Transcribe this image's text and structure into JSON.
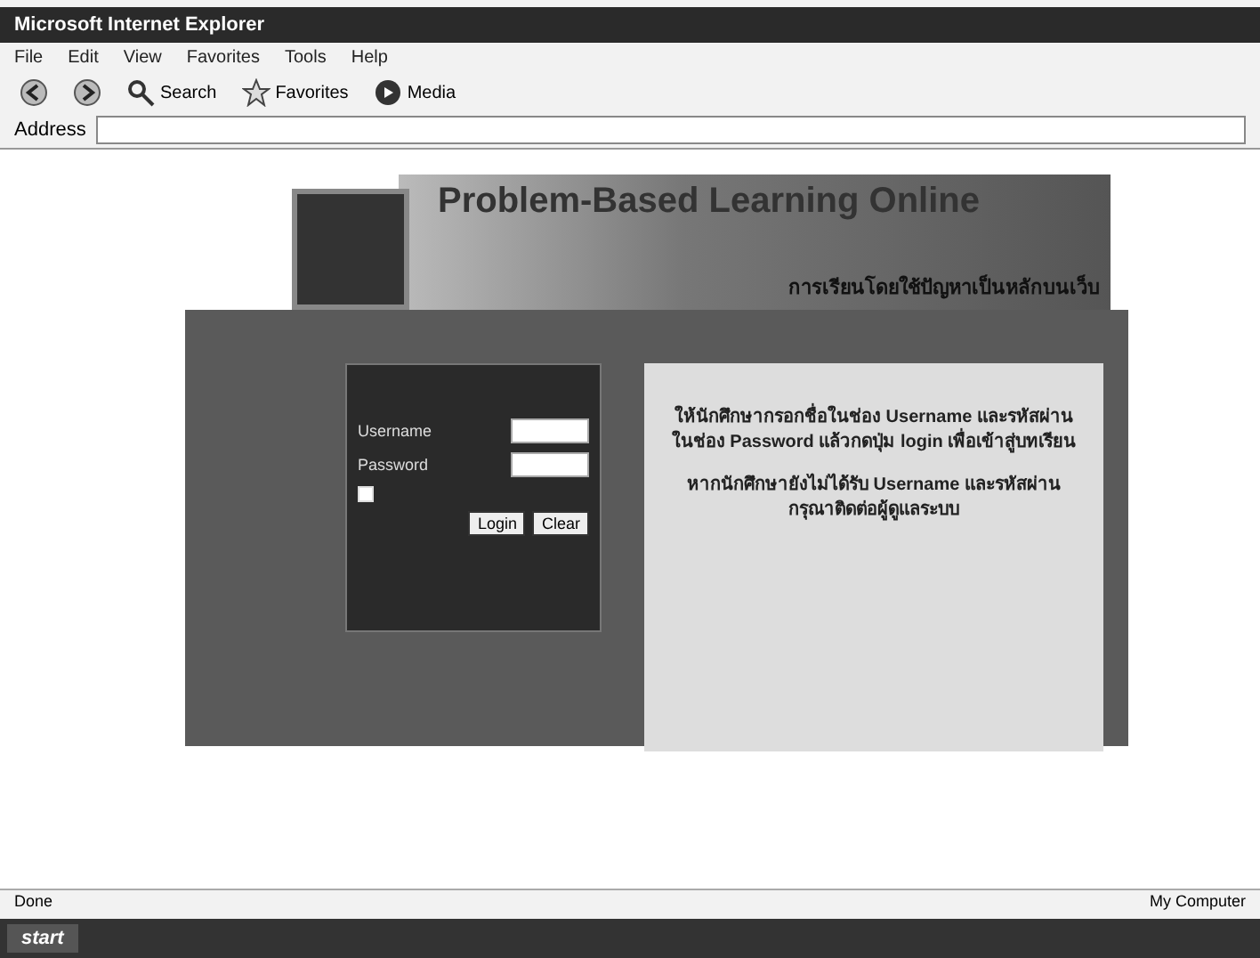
{
  "window": {
    "title": "Microsoft Internet Explorer"
  },
  "menu": [
    "File",
    "Edit",
    "View",
    "Favorites",
    "Tools",
    "Help"
  ],
  "toolbar": [
    {
      "kind": "back"
    },
    {
      "kind": "forward"
    },
    {
      "kind": "search",
      "label": "Search"
    },
    {
      "kind": "favorites",
      "label": "Favorites"
    },
    {
      "kind": "media",
      "label": "Media"
    }
  ],
  "address_bar": {
    "label": "Address"
  },
  "banner": {
    "title": "Problem-Based Learning Online",
    "subtitle": "การเรียนโดยใช้ปัญหาเป็นหลักบนเว็บ"
  },
  "login": {
    "username_label": "Username",
    "password_label": "Password",
    "remember": {
      "checked": false
    },
    "buttons": [
      "Login",
      "Clear"
    ]
  },
  "info": {
    "paragraphs": [
      "ให้นักศึกษากรอกชื่อในช่อง Username และรหัสผ่านในช่อง Password แล้วกดปุ่ม login เพื่อเข้าสู่บทเรียน",
      "หากนักศึกษายังไม่ได้รับ Username และรหัสผ่าน กรุณาติดต่อผู้ดูแลระบบ"
    ]
  },
  "status_bar": {
    "text": "Done",
    "zone": "My Computer"
  },
  "taskbar": {
    "start": "start"
  }
}
